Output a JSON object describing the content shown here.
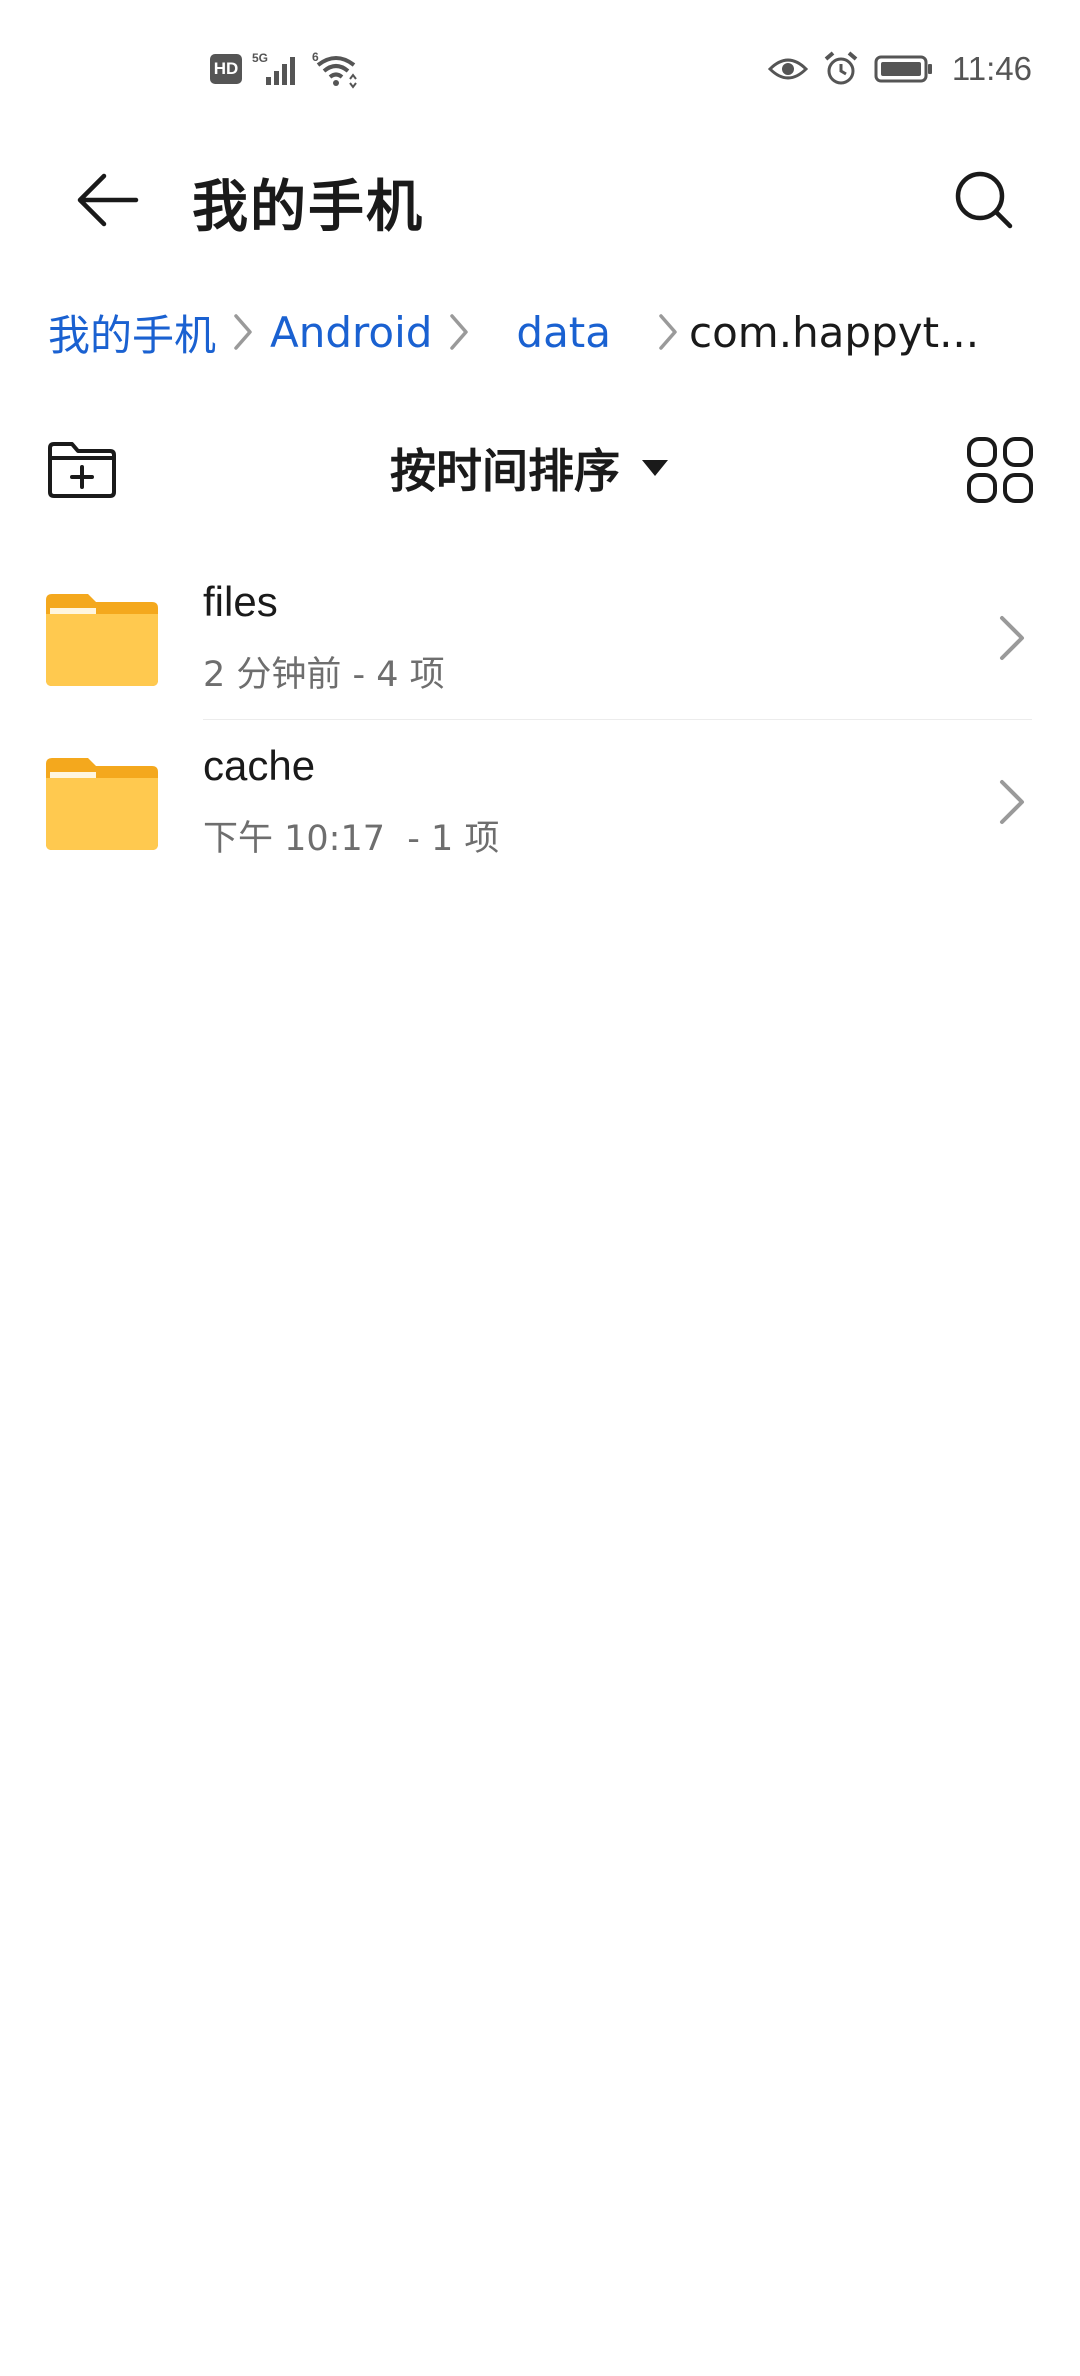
{
  "status_bar": {
    "hd": "HD",
    "network": "5G",
    "wifi_badge": "6",
    "time": "11:46",
    "icons": [
      "hd-icon",
      "signal-5g-icon",
      "wifi-6-icon",
      "eye-comfort-icon",
      "alarm-icon",
      "battery-icon"
    ]
  },
  "header": {
    "title": "我的手机",
    "back_icon": "arrow-left-icon",
    "search_icon": "search-icon"
  },
  "breadcrumb": {
    "items": [
      {
        "label": "我的手机",
        "current": false
      },
      {
        "label": "Android",
        "current": false
      },
      {
        "label": "data",
        "current": false
      },
      {
        "label": "com.happyt...",
        "current": true
      }
    ],
    "separator_icon": "chevron-right-icon",
    "link_color": "#1a61d1"
  },
  "toolbar": {
    "new_folder_icon": "new-folder-icon",
    "sort_label": "按时间排序",
    "sort_icon": "caret-down-icon",
    "view_icon": "grid-view-icon"
  },
  "files": [
    {
      "name": "files",
      "meta": "2 分钟前 - 4 项",
      "icon": "folder-icon"
    },
    {
      "name": "cache",
      "meta": "下午 10:17  - 1 项",
      "icon": "folder-icon"
    }
  ],
  "colors": {
    "folder_body": "#ffc94f",
    "folder_tab": "#f4a81d",
    "accent": "#1a61d1"
  }
}
